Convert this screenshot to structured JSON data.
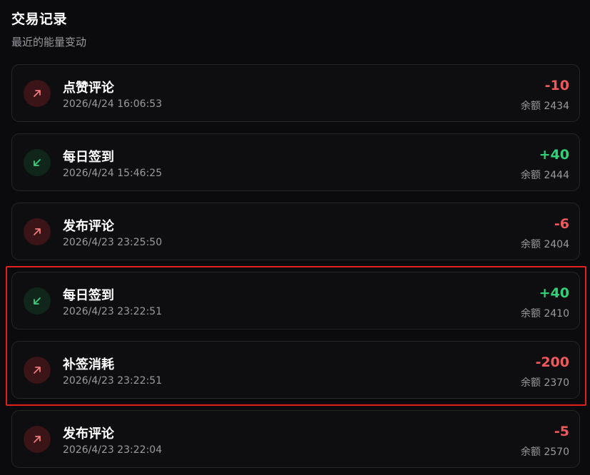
{
  "header": {
    "title": "交易记录",
    "subtitle": "最近的能量变动"
  },
  "transactions": [
    {
      "title": "点赞评论",
      "time": "2026/4/24 16:06:53",
      "amount": "-10",
      "balance": "余额 2434",
      "direction": "out",
      "icon": "arrow-up-right-icon"
    },
    {
      "title": "每日签到",
      "time": "2026/4/24 15:46:25",
      "amount": "+40",
      "balance": "余额 2444",
      "direction": "in",
      "icon": "arrow-down-left-icon"
    },
    {
      "title": "发布评论",
      "time": "2026/4/23 23:25:50",
      "amount": "-6",
      "balance": "余额 2404",
      "direction": "out",
      "icon": "arrow-up-right-icon"
    },
    {
      "title": "每日签到",
      "time": "2026/4/23 23:22:51",
      "amount": "+40",
      "balance": "余额 2410",
      "direction": "in",
      "icon": "arrow-down-left-icon"
    },
    {
      "title": "补签消耗",
      "time": "2026/4/23 23:22:51",
      "amount": "-200",
      "balance": "余额 2370",
      "direction": "out",
      "icon": "arrow-up-right-icon"
    },
    {
      "title": "发布评论",
      "time": "2026/4/23 23:22:04",
      "amount": "-5",
      "balance": "余额 2570",
      "direction": "out",
      "icon": "arrow-up-right-icon"
    }
  ],
  "colors": {
    "out_amount": "#f0595b",
    "in_amount": "#31d17a",
    "highlight_border": "#e0201a"
  }
}
